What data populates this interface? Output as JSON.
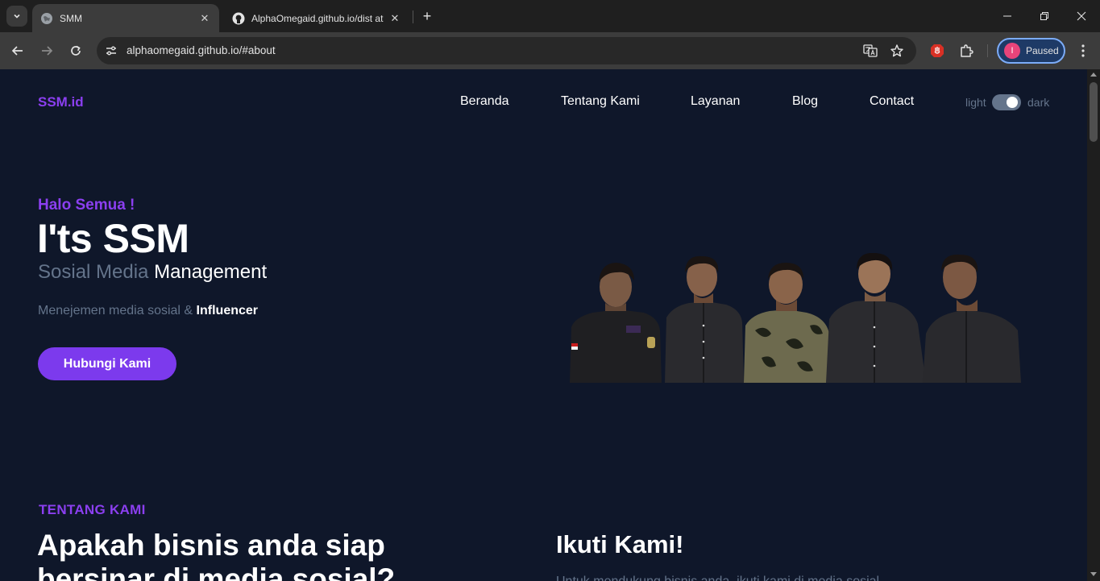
{
  "browser": {
    "tabs": [
      {
        "title": "SMM",
        "favicon": "globe-icon",
        "active": true
      },
      {
        "title": "AlphaOmegaid.github.io/dist at",
        "favicon": "github-icon",
        "active": false
      }
    ],
    "url": "alphaomegaid.github.io/#about",
    "profile_initial": "I",
    "profile_label": "Paused"
  },
  "site": {
    "brand": "SSM.id",
    "nav": [
      "Beranda",
      "Tentang Kami",
      "Layanan",
      "Blog",
      "Contact"
    ],
    "mode_toggle": {
      "light_label": "light",
      "dark_label": "dark",
      "state": "dark"
    }
  },
  "hero": {
    "greeting": "Halo Semua !",
    "title": "I'ts SSM",
    "subtitle_muted": "Sosial Media",
    "subtitle_strong": "Management",
    "desc_muted": "Menejemen media sosial &",
    "desc_strong": "Influencer",
    "cta": "Hubungi Kami"
  },
  "about": {
    "label": "TENTANG KAMI",
    "title": "Apakah bisnis anda siap bersinar di media sosial?",
    "follow_title": "Ikuti Kami!",
    "follow_text": "Untuk mendukung bisnis anda, ikuti kami di media sosial"
  },
  "colors": {
    "page_bg": "#0f172a",
    "accent": "#8b3ff0",
    "button": "#7c3aed",
    "muted_text": "#64748b"
  }
}
